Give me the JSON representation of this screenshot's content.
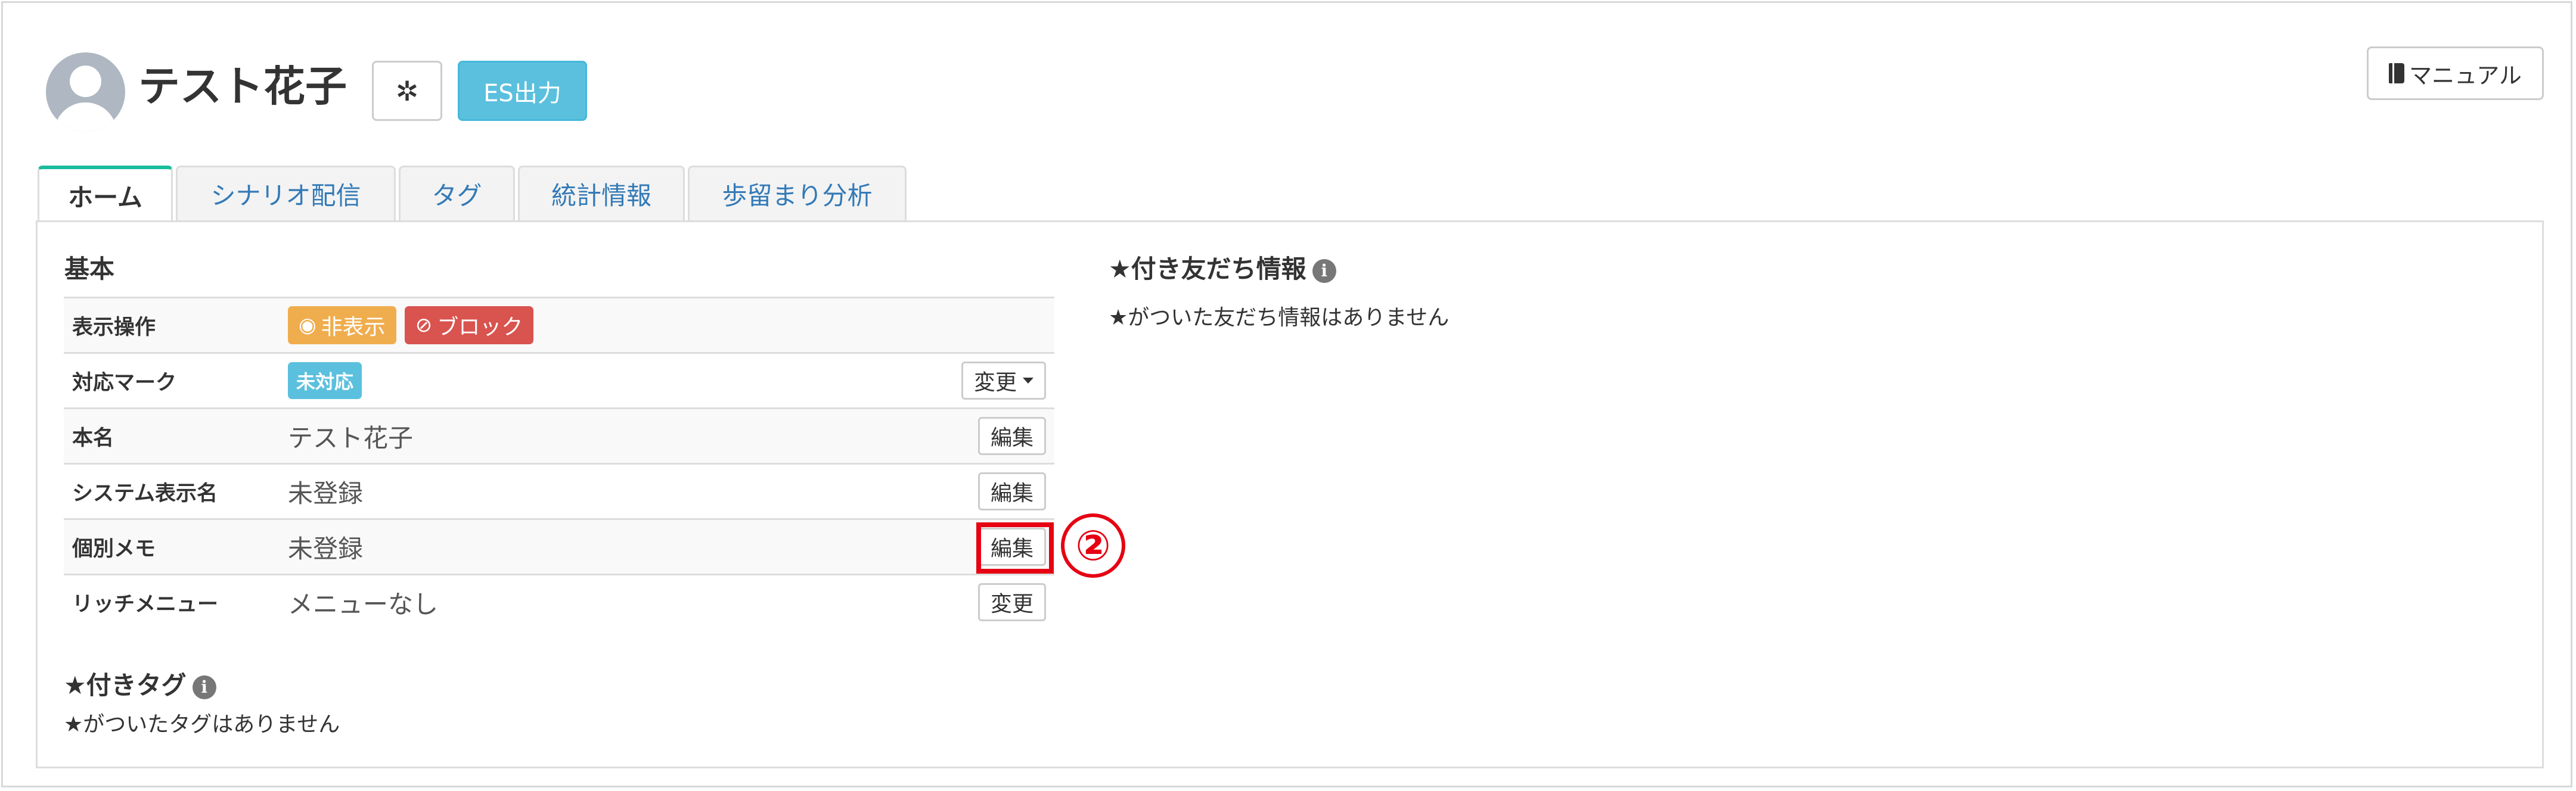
{
  "header": {
    "user_name": "テスト花子",
    "gear_icon": "gear-icon",
    "es_button": "ES出力",
    "manual_button": "マニュアル"
  },
  "tabs": [
    {
      "label": "ホーム",
      "active": true
    },
    {
      "label": "シナリオ配信",
      "active": false
    },
    {
      "label": "タグ",
      "active": false
    },
    {
      "label": "統計情報",
      "active": false
    },
    {
      "label": "歩留まり分析",
      "active": false
    }
  ],
  "basic": {
    "title": "基本",
    "rows": {
      "display_ops": {
        "label": "表示操作",
        "hide": "非表示",
        "block": "ブロック"
      },
      "mark": {
        "label": "対応マーク",
        "badge": "未対応",
        "button": "変更"
      },
      "real_name": {
        "label": "本名",
        "value": "テスト花子",
        "button": "編集"
      },
      "system_name": {
        "label": "システム表示名",
        "value": "未登録",
        "button": "編集"
      },
      "memo": {
        "label": "個別メモ",
        "value": "未登録",
        "button": "編集"
      },
      "rich_menu": {
        "label": "リッチメニュー",
        "value": "メニューなし",
        "button": "変更"
      }
    }
  },
  "starred_tags": {
    "title": "★付きタグ",
    "empty": "★がついたタグはありません"
  },
  "starred_friends": {
    "title": "★付き友だち情報",
    "empty": "★がついた友だち情報はありません"
  },
  "annotation": {
    "number": "②",
    "color": "#e60012"
  }
}
